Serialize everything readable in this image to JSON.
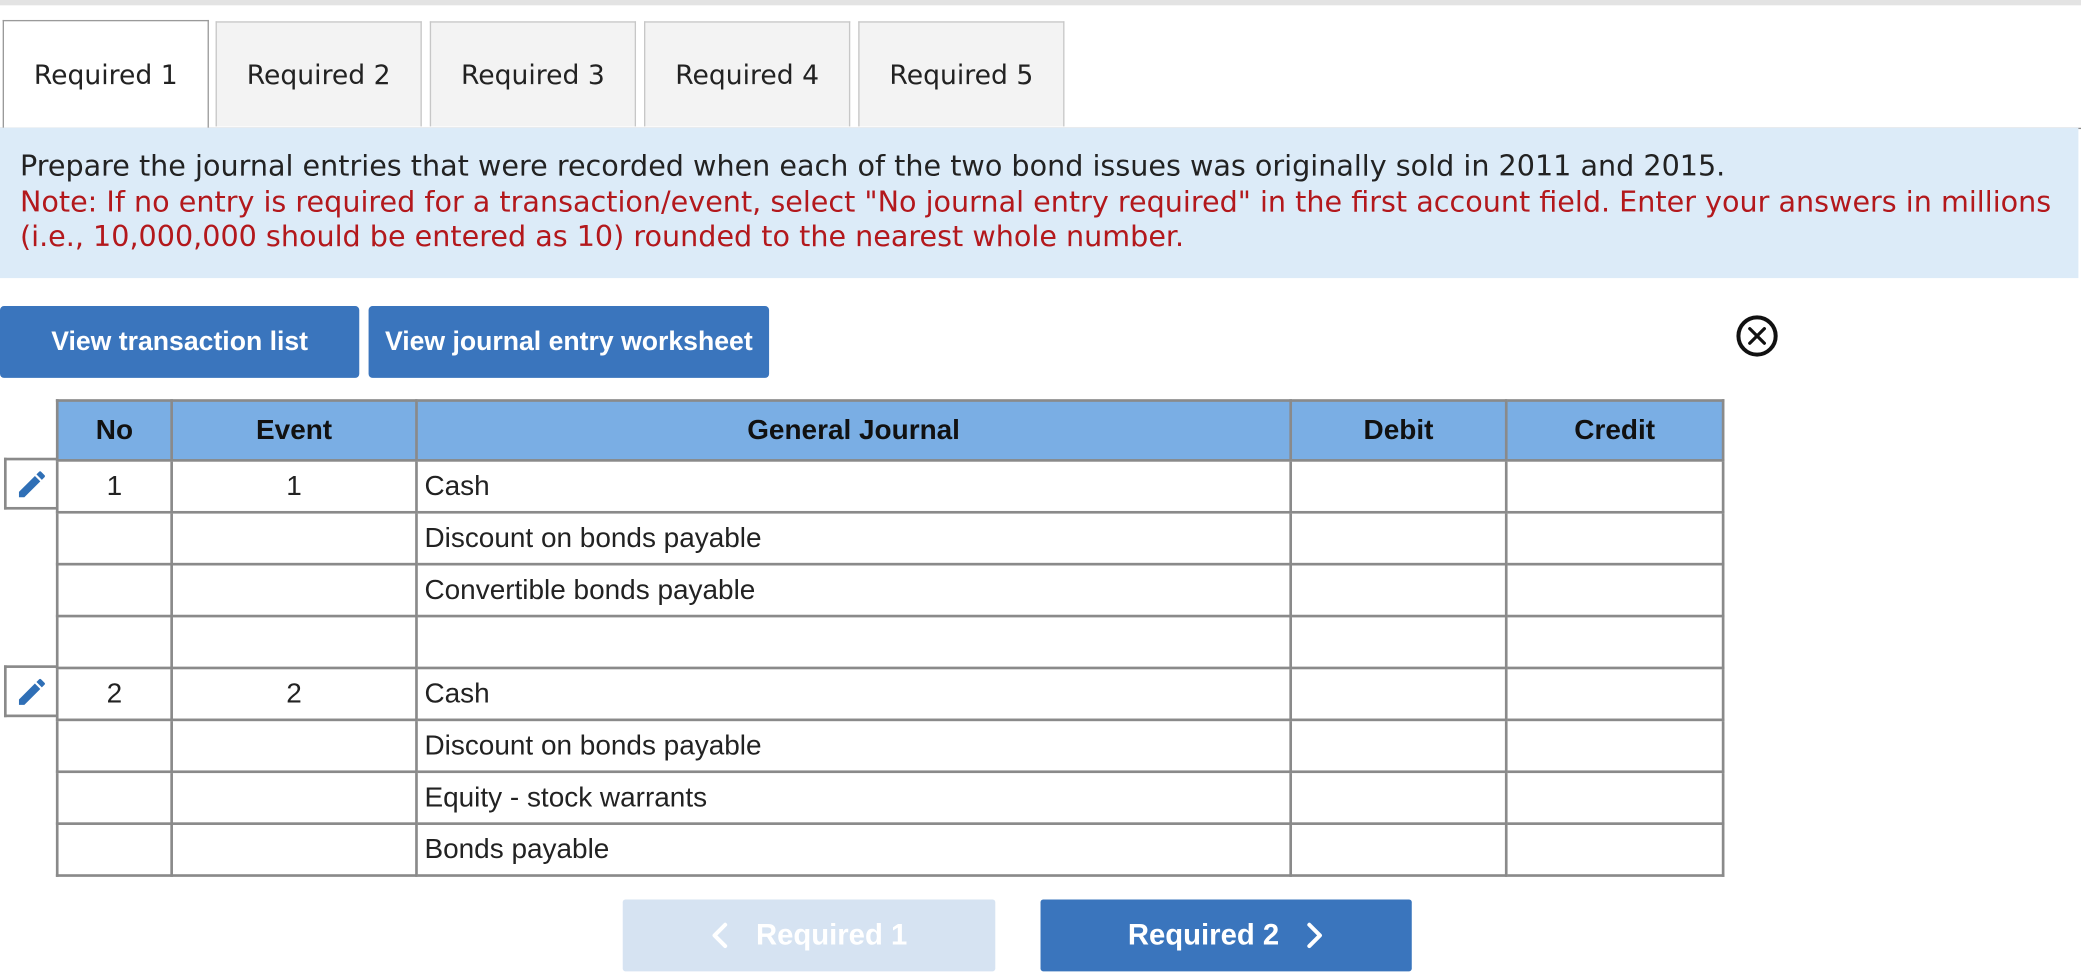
{
  "tabs": [
    {
      "label": "Required 1",
      "active": true
    },
    {
      "label": "Required 2",
      "active": false
    },
    {
      "label": "Required 3",
      "active": false
    },
    {
      "label": "Required 4",
      "active": false
    },
    {
      "label": "Required 5",
      "active": false
    }
  ],
  "instruction": {
    "main": "Prepare the journal entries that were recorded when each of the two bond issues was originally sold in 2011 and 2015.",
    "note": "Note: If no entry is required for a transaction/event, select \"No journal entry required\" in the first account field. Enter your answers in millions (i.e., 10,000,000 should be entered as 10) rounded to the nearest whole number."
  },
  "buttons": {
    "transaction_list": "View transaction list",
    "journal_worksheet": "View journal entry worksheet"
  },
  "table": {
    "headers": {
      "no": "No",
      "event": "Event",
      "general_journal": "General Journal",
      "debit": "Debit",
      "credit": "Credit"
    },
    "rows": [
      {
        "no": "1",
        "event": "1",
        "account": "Cash",
        "debit": "",
        "credit": ""
      },
      {
        "no": "",
        "event": "",
        "account": "Discount on bonds payable",
        "debit": "",
        "credit": ""
      },
      {
        "no": "",
        "event": "",
        "account": "Convertible bonds payable",
        "debit": "",
        "credit": ""
      },
      {
        "no": "",
        "event": "",
        "account": "",
        "debit": "",
        "credit": ""
      },
      {
        "no": "2",
        "event": "2",
        "account": "Cash",
        "debit": "",
        "credit": ""
      },
      {
        "no": "",
        "event": "",
        "account": "Discount on bonds payable",
        "debit": "",
        "credit": ""
      },
      {
        "no": "",
        "event": "",
        "account": "Equity - stock warrants",
        "debit": "",
        "credit": ""
      },
      {
        "no": "",
        "event": "",
        "account": "Bonds payable",
        "debit": "",
        "credit": ""
      }
    ]
  },
  "nav": {
    "prev_label": "Required 1",
    "next_label": "Required 2"
  },
  "icons": {
    "edit": "pencil-icon",
    "close": "close-icon",
    "prev": "chevron-left-icon",
    "next": "chevron-right-icon"
  },
  "colors": {
    "accent_blue": "#3a75bd",
    "header_blue": "#7aaee4",
    "instruction_bg": "#dcebf8",
    "note_red": "#b3181c",
    "disabled_blue": "#d6e3f2"
  }
}
